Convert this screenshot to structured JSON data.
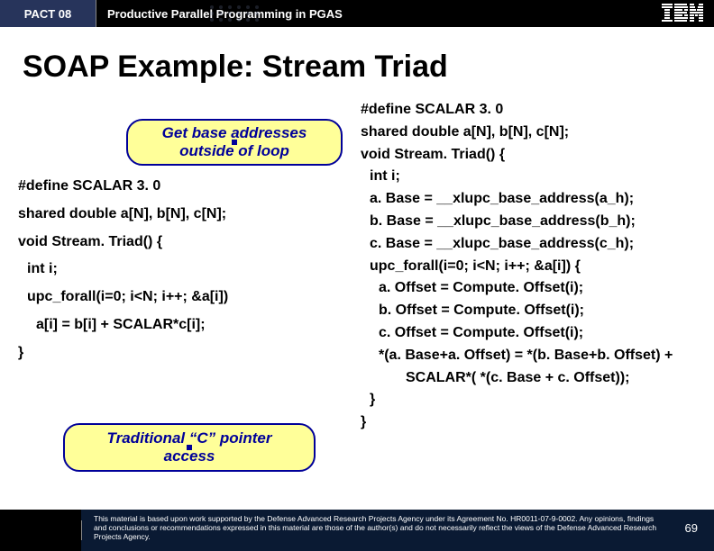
{
  "header": {
    "conference": "PACT 08",
    "topic": "Productive Parallel Programming in PGAS",
    "logo": "IBM"
  },
  "title": "SOAP Example: Stream Triad",
  "callouts": {
    "top_line1": "Get base addresses",
    "top_line2": "outside of loop",
    "bottom_line1": "Traditional “C” pointer",
    "bottom_line2": "access"
  },
  "left_code": {
    "l1": "#define SCALAR 3. 0",
    "l2": "shared double a[N], b[N], c[N];",
    "l3": "void Stream. Triad() {",
    "l4": "int i;",
    "l5": "upc_forall(i=0; i<N; i++; &a[i])",
    "l6": "a[i] = b[i] + SCALAR*c[i];",
    "l7": "}"
  },
  "right_code": {
    "r1": "#define SCALAR 3. 0",
    "r2": "shared double a[N], b[N], c[N];",
    "r3": "void Stream. Triad() {",
    "r4": "int i;",
    "r5": "a. Base = __xlupc_base_address(a_h);",
    "r6": "b. Base = __xlupc_base_address(b_h);",
    "r7": "c. Base = __xlupc_base_address(c_h);",
    "r8": "upc_forall(i=0; i<N; i++; &a[i]) {",
    "r9": "a. Offset = Compute. Offset(i);",
    "r10": "b. Offset = Compute. Offset(i);",
    "r11": "c. Offset = Compute. Offset(i);",
    "r12": "*(a. Base+a. Offset) = *(b. Base+b. Offset) +",
    "r13": "SCALAR*( *(c. Base + c. Offset));",
    "r14": "}",
    "r15": "}"
  },
  "footer": {
    "disclaimer": "This material is based upon work supported by the Defense Advanced Research Projects Agency under its Agreement No. HR0011-07-9-0002. Any opinions, findings and conclusions or recommendations expressed in this material are those of the author(s) and do not necessarily reflect the views of the Defense Advanced Research Projects Agency.",
    "page": "69"
  }
}
